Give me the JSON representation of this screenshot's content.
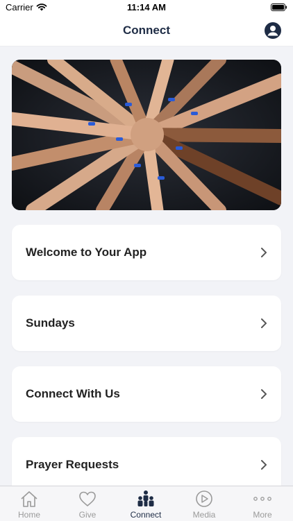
{
  "status_bar": {
    "carrier": "Carrier",
    "time": "11:14 AM"
  },
  "header": {
    "title": "Connect"
  },
  "cards": [
    {
      "label": "Welcome to Your App"
    },
    {
      "label": "Sundays"
    },
    {
      "label": "Connect With Us"
    },
    {
      "label": "Prayer Requests"
    }
  ],
  "tabs": [
    {
      "label": "Home",
      "icon": "home-icon"
    },
    {
      "label": "Give",
      "icon": "heart-icon"
    },
    {
      "label": "Connect",
      "icon": "people-icon"
    },
    {
      "label": "Media",
      "icon": "play-icon"
    },
    {
      "label": "More",
      "icon": "more-icon"
    }
  ],
  "active_tab": "Connect",
  "colors": {
    "accent": "#1e2c45",
    "inactive": "#9a9a9a",
    "background": "#f2f3f7"
  }
}
